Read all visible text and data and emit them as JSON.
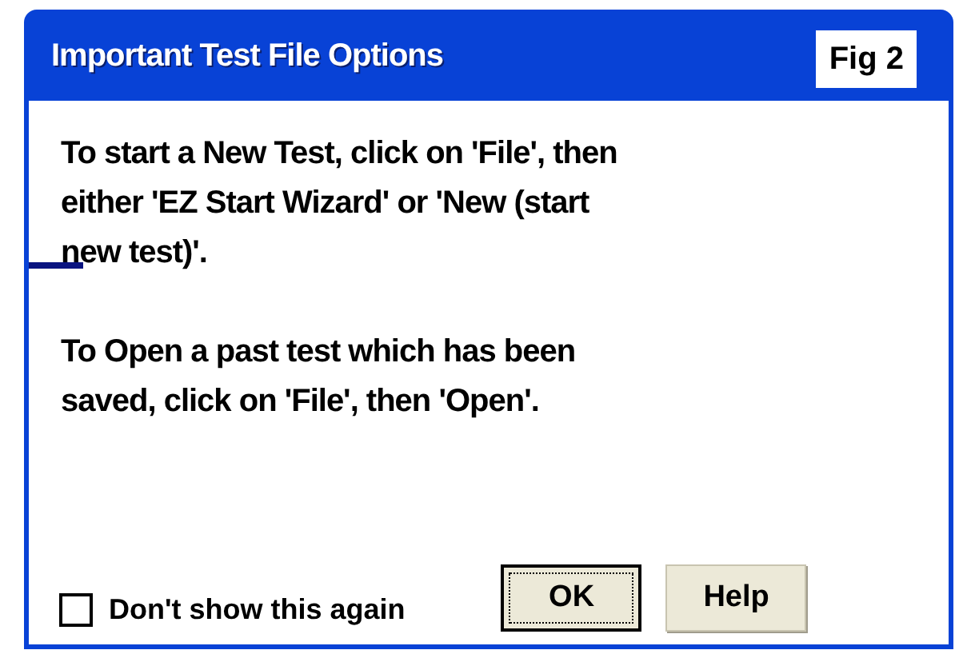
{
  "window": {
    "title": "Important Test File Options",
    "figure_label": "Fig 2"
  },
  "paragraphs": [
    [
      "To start a New Test, click on 'File', then",
      "either 'EZ Start Wizard' or 'New (start",
      "new test)'."
    ],
    [
      "To Open a past test which has been",
      "saved, click on 'File', then 'Open'."
    ]
  ],
  "checkbox": {
    "label": "Don't show this again",
    "checked": false
  },
  "buttons": [
    {
      "label": "OK",
      "default": true
    },
    {
      "label": "Help",
      "default": false
    }
  ]
}
